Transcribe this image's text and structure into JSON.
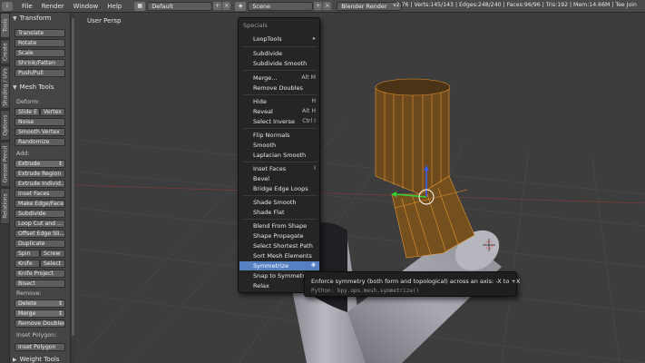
{
  "header": {
    "menus": [
      "File",
      "Render",
      "Window",
      "Help"
    ],
    "layout": "Default",
    "scene": "Scene",
    "engine": "Blender Render",
    "stats": "v2.76 | Verts:145/143 | Edges:248/240 | Faces:96/96 | Tris:192 | Mem:14.66M | Tee Join"
  },
  "tabs": [
    "Tools",
    "Create",
    "Shading / UVs",
    "Options",
    "Grease Pencil",
    "Relations"
  ],
  "toolshelf": {
    "transform": {
      "title": "Transform",
      "buttons": [
        "Translate",
        "Rotate",
        "Scale",
        "Shrink/Fatten",
        "Push/Pull"
      ]
    },
    "mesh_tools": {
      "title": "Mesh Tools",
      "deform_label": "Deform:",
      "slide_edge": "Slide E",
      "vertex": "Vertex",
      "noise": "Noise",
      "smooth_vertex": "Smooth Vertex",
      "randomize": "Randomize",
      "add_label": "Add:",
      "extrude_dd": "Extrude",
      "extrude_region": "Extrude Region",
      "extrude_individual": "Extrude Individ...",
      "inset_faces": "Inset Faces",
      "make_edge_face": "Make Edge/Face",
      "subdivide": "Subdivide",
      "loop_cut": "Loop Cut and ...",
      "offset_edge": "Offset Edge Sli...",
      "duplicate": "Duplicate",
      "spin": "Spin",
      "screw": "Screw",
      "knife": "Knife",
      "select": "Select",
      "knife_project": "Knife Project",
      "bisect": "Bisect",
      "remove_label": "Remove:",
      "delete_dd": "Delete",
      "merge_dd": "Merge",
      "remove_doubles": "Remove Doubles"
    },
    "inset_polygon": {
      "label": "Inset Polygon:",
      "button": "Inset Polygon"
    },
    "next_section": "Weight Tools"
  },
  "viewport": {
    "label": "User Persp"
  },
  "specials_menu": {
    "title": "Specials",
    "items": [
      {
        "label": "LoopTools",
        "shortcut": "▸"
      },
      {
        "label": "Subdivide",
        "shortcut": ""
      },
      {
        "label": "Subdivide Smooth",
        "shortcut": ""
      },
      {
        "label": "Merge...",
        "shortcut": "Alt M"
      },
      {
        "label": "Remove Doubles",
        "shortcut": ""
      },
      {
        "label": "Hide",
        "shortcut": "H"
      },
      {
        "label": "Reveal",
        "shortcut": "Alt H"
      },
      {
        "label": "Select Inverse",
        "shortcut": "Ctrl I"
      },
      {
        "label": "Flip Normals",
        "shortcut": ""
      },
      {
        "label": "Smooth",
        "shortcut": ""
      },
      {
        "label": "Laplacian Smooth",
        "shortcut": ""
      },
      {
        "label": "Inset Faces",
        "shortcut": "I"
      },
      {
        "label": "Bevel",
        "shortcut": ""
      },
      {
        "label": "Bridge Edge Loops",
        "shortcut": ""
      },
      {
        "label": "Shade Smooth",
        "shortcut": ""
      },
      {
        "label": "Shade Flat",
        "shortcut": ""
      },
      {
        "label": "Blend From Shape",
        "shortcut": ""
      },
      {
        "label": "Shape Propagate",
        "shortcut": ""
      },
      {
        "label": "Select Shortest Path",
        "shortcut": ""
      },
      {
        "label": "Sort Mesh Elements",
        "shortcut": ""
      },
      {
        "label": "Symmetrize",
        "shortcut": ""
      },
      {
        "label": "Snap to Symmetry",
        "shortcut": ""
      },
      {
        "label": "Relax",
        "shortcut": ""
      }
    ],
    "highlighted": "Symmetrize"
  },
  "tooltip": {
    "description": "Enforce symmetry (both form and topological) across an axis: -X to +X",
    "python": "Python: bpy.ops.mesh.symmetrize()"
  },
  "colors": {
    "accent": "#5680c2",
    "selection": "#e8952d",
    "background": "#3d3d3d"
  }
}
